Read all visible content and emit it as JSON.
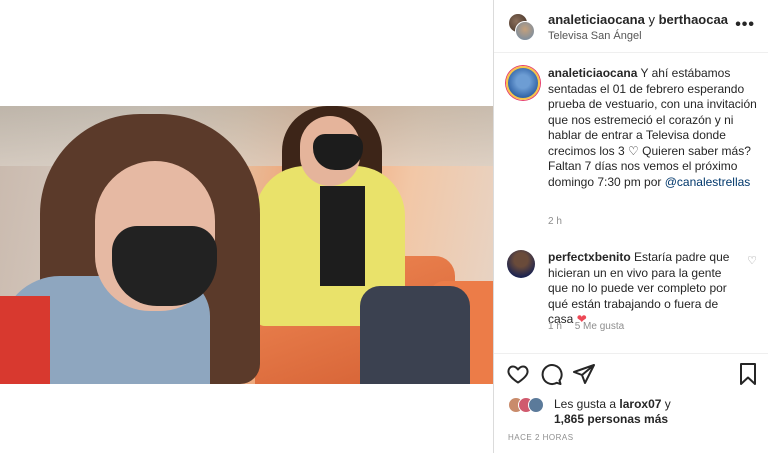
{
  "header": {
    "user1": "analeticiaocana",
    "joiner": "y",
    "user2": "berthaocaa",
    "location": "Televisa San Ángel"
  },
  "caption": {
    "username": "analeticiaocana",
    "text1": "Y ahí estábamos sentadas el 01 de febrero esperando prueba de vestuario, con una invitación que nos estremeció el corazón y ni hablar de entrar a Televisa donde crecimos los 3",
    "text2": "Quieren saber más? Faltan 7 días nos vemos el próximo domingo 7:30 pm por",
    "mention": "@canalestrellas",
    "time": "2 h"
  },
  "comment": {
    "username": "perfectxbenito",
    "text": "Estaría padre que hicieran un en vivo para la gente que no lo puede ver completo por qué están trabajando o fuera de casa",
    "time": "1 h",
    "likes": "5 Me gusta"
  },
  "likes": {
    "prefix": "Les gusta a",
    "user": "larox07",
    "joiner": "y",
    "count": "1,865 personas más"
  },
  "posted": "HACE 2 HORAS",
  "icons": {
    "more": "more-icon",
    "like": "heart-icon",
    "comment": "comment-icon",
    "share": "share-icon",
    "save": "bookmark-icon"
  },
  "colors": {
    "mention": "#00376b",
    "heart": "#ed4956",
    "muted": "#8e8e8e"
  }
}
